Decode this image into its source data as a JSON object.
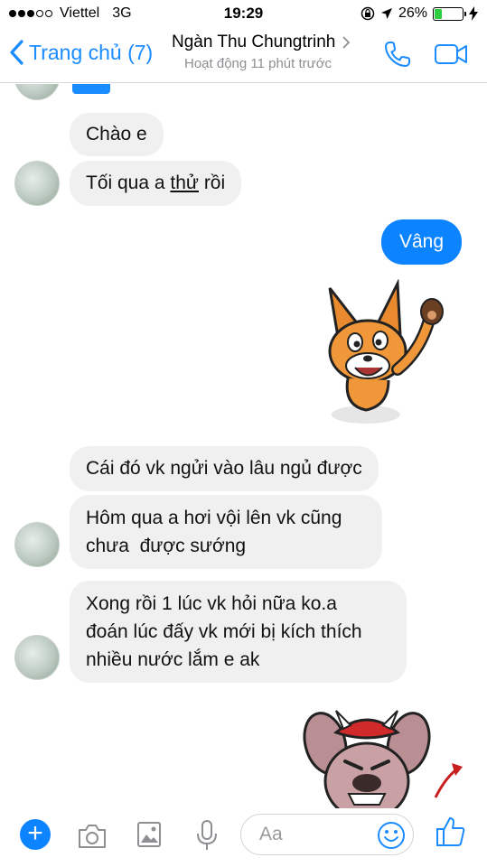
{
  "status_bar": {
    "carrier": "Viettel",
    "network": "3G",
    "time": "19:29",
    "battery": "26%",
    "battery_level": 0.26,
    "signal_bars_filled": 3,
    "signal_bars_total": 5
  },
  "nav": {
    "back_label": "Trang chủ (7)",
    "contact_name": "Ngàn Thu Chungtrinh",
    "presence": "Hoạt động 11 phút trước",
    "accent_color": "#1a8cff"
  },
  "messages": {
    "m1": "Chào e",
    "m2_prefix": "Tối qua a ",
    "m2_underlined": "thử",
    "m2_suffix": " rồi",
    "m3": "Vâng",
    "m4": "Cái đó vk ngửi vào lâu ngủ được",
    "m5_line1": "Hôm qua a hơi vội lên vk cũng",
    "m5_line2": "chưa  được sướng",
    "m6_line1": "Xong rồi 1 lúc vk hỏi nữa ko.a",
    "m6_line2": "đoán lúc đấy vk mới bị kích thích",
    "m6_line3": "nhiều nước lắm e ak"
  },
  "stickers": {
    "fox": "fox-waving-sticker",
    "devil": "devil-mouse-sticker"
  },
  "composer": {
    "placeholder": "Aa",
    "outgoing_color": "#0d84ff"
  },
  "icons": [
    "back-chevron-icon",
    "phone-icon",
    "video-camera-icon",
    "plus-icon",
    "camera-icon",
    "gallery-icon",
    "microphone-icon",
    "emoji-icon",
    "thumbs-up-icon"
  ]
}
